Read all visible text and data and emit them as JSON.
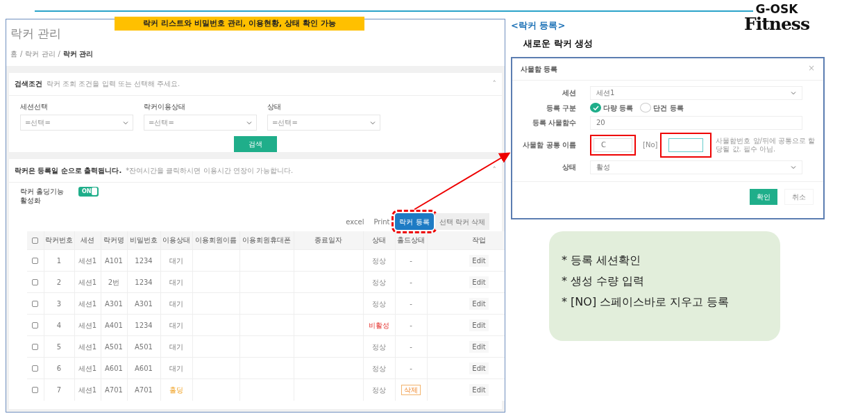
{
  "slide": {
    "banner": "락커 리스트와 비밀번호 관리, 이용현황, 상태 확인 가능",
    "heading": "<락커 등록>",
    "subheading": "새로운 락커 생성",
    "logo": {
      "line_1": "G-OSK",
      "line_2": "Fitness"
    },
    "notes": [
      "* 등록 세션확인",
      "* 생성 수량 입력",
      "* [NO] 스페이스바로 지우고 등록"
    ]
  },
  "page": {
    "title": "락커 관리",
    "breadcrumb_separator": "/",
    "breadcrumb": [
      {
        "label": "홈",
        "selected": false
      },
      {
        "label": "락커 관리",
        "selected": false
      },
      {
        "label": "락커 관리",
        "selected": true
      }
    ],
    "search": {
      "title": "검색조건",
      "hint": "락커 조회 조건을 입력 또는 선택해 주세요.",
      "collapse": "˄",
      "filters": [
        {
          "label": "세션선택",
          "value": "=선택="
        },
        {
          "label": "락커이용상태",
          "value": "=선택="
        },
        {
          "label": "상태",
          "value": "=선택="
        }
      ],
      "button": "검색"
    },
    "list": {
      "title": "락커은 등록일 순으로 출력됩니다.",
      "hint": "*잔여시간을 클릭하시면 이용시간 연장이 가능합니다.",
      "collapse": "˄",
      "holding_toggle": {
        "label": "락커 홀딩기능 활성화",
        "on": true,
        "text": "ON"
      },
      "buttons": [
        {
          "label": "excel",
          "kind": "plain",
          "highlighted": false
        },
        {
          "label": "Print",
          "kind": "plain",
          "highlighted": false
        },
        {
          "label": "락커 등록",
          "kind": "primary",
          "highlighted": true
        },
        {
          "label": "선택 락커 삭제",
          "kind": "grey",
          "highlighted": false
        }
      ],
      "header_checked": false,
      "columns": [
        "락커번호",
        "세션",
        "락커명",
        "비밀번호",
        "이용상태",
        "이용회원이름",
        "이용회원휴대폰",
        "종료일자",
        "상태",
        "홀드상태",
        "작업"
      ],
      "rows": [
        {
          "checked": false,
          "number": "1",
          "session": "세션1",
          "name": "A101",
          "password": "1234",
          "usage": {
            "text": "대기",
            "kind": "waiting"
          },
          "status": {
            "text": "정상",
            "kind": "normal"
          },
          "hold": {
            "text": "-",
            "kind": "none"
          },
          "action": "Edit"
        },
        {
          "checked": false,
          "number": "2",
          "session": "세션1",
          "name": "2번",
          "password": "1234",
          "usage": {
            "text": "대기",
            "kind": "waiting"
          },
          "status": {
            "text": "정상",
            "kind": "normal"
          },
          "hold": {
            "text": "-",
            "kind": "none"
          },
          "action": "Edit"
        },
        {
          "checked": false,
          "number": "3",
          "session": "세션1",
          "name": "A301",
          "password": "A301",
          "usage": {
            "text": "대기",
            "kind": "waiting"
          },
          "status": {
            "text": "정상",
            "kind": "normal"
          },
          "hold": {
            "text": "-",
            "kind": "none"
          },
          "action": "Edit"
        },
        {
          "checked": false,
          "number": "4",
          "session": "세션1",
          "name": "A401",
          "password": "1234",
          "usage": {
            "text": "대기",
            "kind": "waiting"
          },
          "status": {
            "text": "비활성",
            "kind": "inactive"
          },
          "hold": {
            "text": "-",
            "kind": "none"
          },
          "action": "Edit"
        },
        {
          "checked": false,
          "number": "5",
          "session": "세션1",
          "name": "A501",
          "password": "A501",
          "usage": {
            "text": "대기",
            "kind": "waiting"
          },
          "status": {
            "text": "정상",
            "kind": "normal"
          },
          "hold": {
            "text": "-",
            "kind": "none"
          },
          "action": "Edit"
        },
        {
          "checked": false,
          "number": "6",
          "session": "세션1",
          "name": "A601",
          "password": "A601",
          "usage": {
            "text": "대기",
            "kind": "waiting"
          },
          "status": {
            "text": "정상",
            "kind": "normal"
          },
          "hold": {
            "text": "-",
            "kind": "none"
          },
          "action": "Edit"
        },
        {
          "checked": false,
          "number": "7",
          "session": "세션1",
          "name": "A701",
          "password": "A701",
          "usage": {
            "text": "홀딩",
            "kind": "holding"
          },
          "status": {
            "text": "정상",
            "kind": "normal"
          },
          "hold": {
            "text": "삭제",
            "kind": "button"
          },
          "action": "Edit"
        }
      ]
    }
  },
  "modal": {
    "title": "사물함 등록",
    "close": "×",
    "session": {
      "label": "세션",
      "value": "세션1"
    },
    "mode": {
      "label": "등록 구분",
      "options": [
        {
          "label": "다량 등록",
          "selected": true
        },
        {
          "label": "단건 등록",
          "selected": false
        }
      ]
    },
    "count": {
      "label": "등록 사물함수",
      "value": "20"
    },
    "common_name": {
      "label": "사물함 공통 이름",
      "prefix": {
        "value": "C",
        "highlighted": true
      },
      "separator": "[No]",
      "suffix": {
        "highlighted": true
      },
      "help": "사물함번호 앞/뒤에 공통으로 할당될 값. 필수 아님."
    },
    "status": {
      "label": "상태",
      "value": "활성"
    },
    "buttons": [
      {
        "label": "확인",
        "kind": "primary"
      },
      {
        "label": "취소",
        "kind": "plain"
      }
    ]
  }
}
